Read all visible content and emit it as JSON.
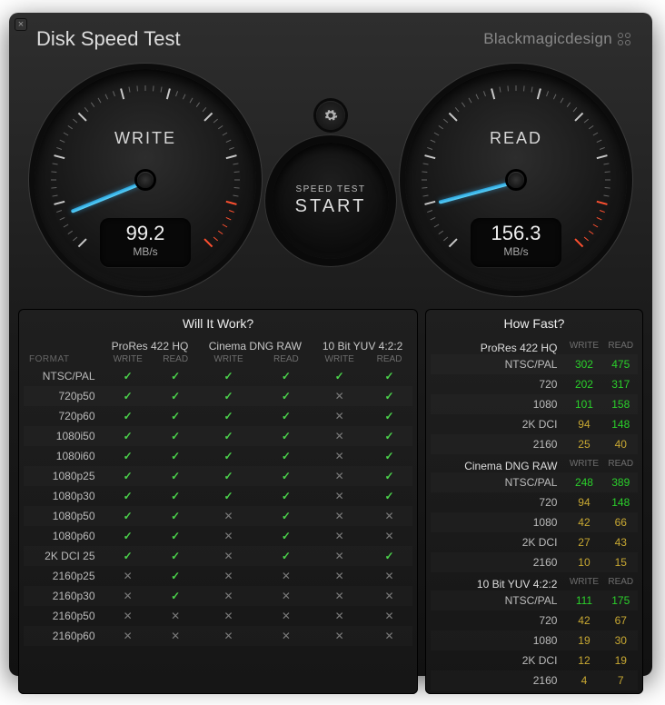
{
  "title": "Disk Speed Test",
  "brand": "Blackmagicdesign",
  "start_button": {
    "small": "SPEED TEST",
    "big": "START"
  },
  "gauges": {
    "write": {
      "label": "WRITE",
      "value": "99.2",
      "unit": "MB/s",
      "angle": 158
    },
    "read": {
      "label": "READ",
      "value": "156.3",
      "unit": "MB/s",
      "angle": 165
    }
  },
  "section_titles": {
    "wiw": "Will It Work?",
    "hf": "How Fast?"
  },
  "wiw": {
    "codecs": [
      "ProRes 422 HQ",
      "Cinema DNG RAW",
      "10 Bit YUV 4:2:2"
    ],
    "sub": [
      "WRITE",
      "READ"
    ],
    "format_label": "FORMAT",
    "rows": [
      {
        "f": "NTSC/PAL",
        "c": [
          1,
          1,
          1,
          1,
          1,
          1
        ]
      },
      {
        "f": "720p50",
        "c": [
          1,
          1,
          1,
          1,
          0,
          1
        ]
      },
      {
        "f": "720p60",
        "c": [
          1,
          1,
          1,
          1,
          0,
          1
        ]
      },
      {
        "f": "1080i50",
        "c": [
          1,
          1,
          1,
          1,
          0,
          1
        ]
      },
      {
        "f": "1080i60",
        "c": [
          1,
          1,
          1,
          1,
          0,
          1
        ]
      },
      {
        "f": "1080p25",
        "c": [
          1,
          1,
          1,
          1,
          0,
          1
        ]
      },
      {
        "f": "1080p30",
        "c": [
          1,
          1,
          1,
          1,
          0,
          1
        ]
      },
      {
        "f": "1080p50",
        "c": [
          1,
          1,
          0,
          1,
          0,
          0
        ]
      },
      {
        "f": "1080p60",
        "c": [
          1,
          1,
          0,
          1,
          0,
          0
        ]
      },
      {
        "f": "2K DCI 25",
        "c": [
          1,
          1,
          0,
          1,
          0,
          1
        ]
      },
      {
        "f": "2160p25",
        "c": [
          0,
          1,
          0,
          0,
          0,
          0
        ]
      },
      {
        "f": "2160p30",
        "c": [
          0,
          1,
          0,
          0,
          0,
          0
        ]
      },
      {
        "f": "2160p50",
        "c": [
          0,
          0,
          0,
          0,
          0,
          0
        ]
      },
      {
        "f": "2160p60",
        "c": [
          0,
          0,
          0,
          0,
          0,
          0
        ]
      }
    ]
  },
  "hf": {
    "sub": [
      "WRITE",
      "READ"
    ],
    "sections": [
      {
        "name": "ProRes 422 HQ",
        "rows": [
          {
            "f": "NTSC/PAL",
            "w": "302",
            "r": "475"
          },
          {
            "f": "720",
            "w": "202",
            "r": "317"
          },
          {
            "f": "1080",
            "w": "101",
            "r": "158"
          },
          {
            "f": "2K DCI",
            "w": "94",
            "ww": true,
            "r": "148"
          },
          {
            "f": "2160",
            "w": "25",
            "ww": true,
            "r": "40",
            "rw": true
          }
        ]
      },
      {
        "name": "Cinema DNG RAW",
        "rows": [
          {
            "f": "NTSC/PAL",
            "w": "248",
            "r": "389"
          },
          {
            "f": "720",
            "w": "94",
            "ww": true,
            "r": "148"
          },
          {
            "f": "1080",
            "w": "42",
            "ww": true,
            "r": "66",
            "rw": true
          },
          {
            "f": "2K DCI",
            "w": "27",
            "ww": true,
            "r": "43",
            "rw": true
          },
          {
            "f": "2160",
            "w": "10",
            "ww": true,
            "r": "15",
            "rw": true
          }
        ]
      },
      {
        "name": "10 Bit YUV 4:2:2",
        "rows": [
          {
            "f": "NTSC/PAL",
            "w": "111",
            "r": "175"
          },
          {
            "f": "720",
            "w": "42",
            "ww": true,
            "r": "67",
            "rw": true
          },
          {
            "f": "1080",
            "w": "19",
            "ww": true,
            "r": "30",
            "rw": true
          },
          {
            "f": "2K DCI",
            "w": "12",
            "ww": true,
            "r": "19",
            "rw": true
          },
          {
            "f": "2160",
            "w": "4",
            "ww": true,
            "r": "7",
            "rw": true
          }
        ]
      }
    ]
  }
}
